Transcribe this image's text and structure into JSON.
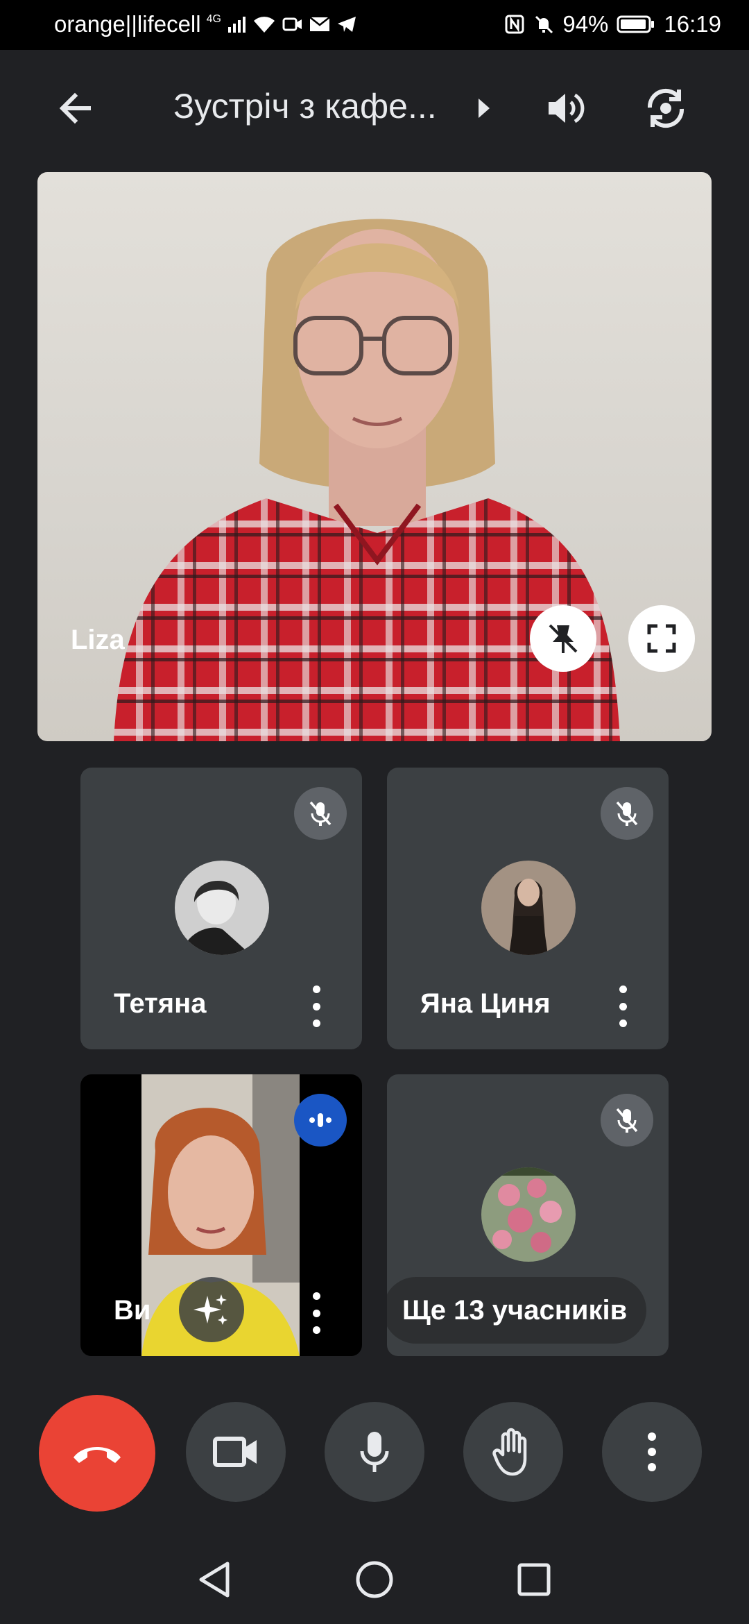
{
  "status_bar": {
    "carrier": "orange||lifecell",
    "network": "4G",
    "battery": "94%",
    "time": "16:19"
  },
  "top_bar": {
    "title": "Зустріч з кафе...",
    "icons": [
      "back-arrow-icon",
      "chevron-right-icon",
      "speaker-icon",
      "switch-camera-icon"
    ]
  },
  "main_tile": {
    "name": "Liza",
    "icons": [
      "unpin-icon",
      "fullscreen-icon"
    ]
  },
  "participants": [
    {
      "name": "Тетяна",
      "muted": true
    },
    {
      "name": "Яна Циня",
      "muted": true
    },
    {
      "name": "Ви",
      "speaking": true
    },
    {
      "name": "Ще 13 учасників",
      "muted": true
    }
  ],
  "controls": [
    "end-call",
    "camera",
    "microphone",
    "raise-hand",
    "more-options"
  ],
  "colors": {
    "background": "#202124",
    "tile": "#3c4043",
    "end_call": "#ea4335",
    "speaking_badge": "#1a56c4"
  }
}
